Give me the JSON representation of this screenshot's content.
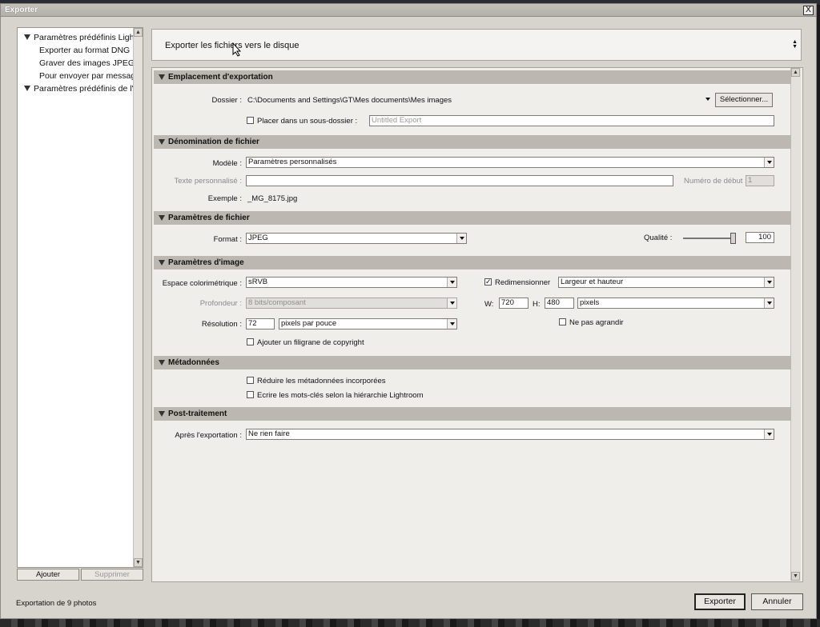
{
  "window": {
    "title": "Exporter",
    "close_label": "X"
  },
  "presets": {
    "items": [
      {
        "label": "Paramètres prédéfinis Lightroom",
        "expanded": true
      },
      {
        "label": "Exporter au format DNG"
      },
      {
        "label": "Graver des images JPEG en pleine taille"
      },
      {
        "label": "Pour envoyer par messagerie"
      },
      {
        "label": "Paramètres prédéfinis de l'utilisateur",
        "expanded": true
      }
    ],
    "add_label": "Ajouter",
    "remove_label": "Supprimer"
  },
  "destination": {
    "label": "Exporter les fichiers vers le disque"
  },
  "sections": {
    "location": {
      "title": "Emplacement d'exportation",
      "folder_label": "Dossier :",
      "folder_value": "C:\\Documents and Settings\\GT\\Mes documents\\Mes images",
      "select_button": "Sélectionner...",
      "subfolder_label": "Placer dans un sous-dossier :",
      "subfolder_placeholder": "Untitled Export"
    },
    "naming": {
      "title": "Dénomination de fichier",
      "template_label": "Modèle :",
      "template_value": "Paramètres personnalisés",
      "custom_text_label": "Texte personnalisé :",
      "custom_text_value": "",
      "start_number_label": "Numéro de début :",
      "start_number_value": "1",
      "example_label": "Exemple :",
      "example_value": "_MG_8175.jpg"
    },
    "file": {
      "title": "Paramètres de fichier",
      "format_label": "Format :",
      "format_value": "JPEG",
      "quality_label": "Qualité :",
      "quality_value": "100",
      "quality_fraction": 1.0
    },
    "image": {
      "title": "Paramètres d'image",
      "colorspace_label": "Espace colorimétrique :",
      "colorspace_value": "sRVB",
      "depth_label": "Profondeur :",
      "depth_value": "8 bits/composant",
      "resolution_label": "Résolution :",
      "resolution_value": "72",
      "resolution_unit": "pixels par pouce",
      "watermark_label": "Ajouter un filigrane de copyright",
      "resize_label": "Redimensionner",
      "resize_checked": true,
      "resize_mode": "Largeur et hauteur",
      "w_label": "W:",
      "w_value": "720",
      "h_label": "H:",
      "h_value": "480",
      "size_unit": "pixels",
      "no_enlarge_label": "Ne pas agrandir"
    },
    "metadata": {
      "title": "Métadonnées",
      "minimize_label": "Réduire les métadonnées incorporées",
      "hierarchy_label": "Ecrire les mots-clés selon la hiérarchie Lightroom"
    },
    "post": {
      "title": "Post-traitement",
      "after_label": "Après l'exportation :",
      "after_value": "Ne rien faire"
    }
  },
  "footer": {
    "status": "Exportation de 9 photos",
    "export_label": "Exporter",
    "cancel_label": "Annuler"
  }
}
